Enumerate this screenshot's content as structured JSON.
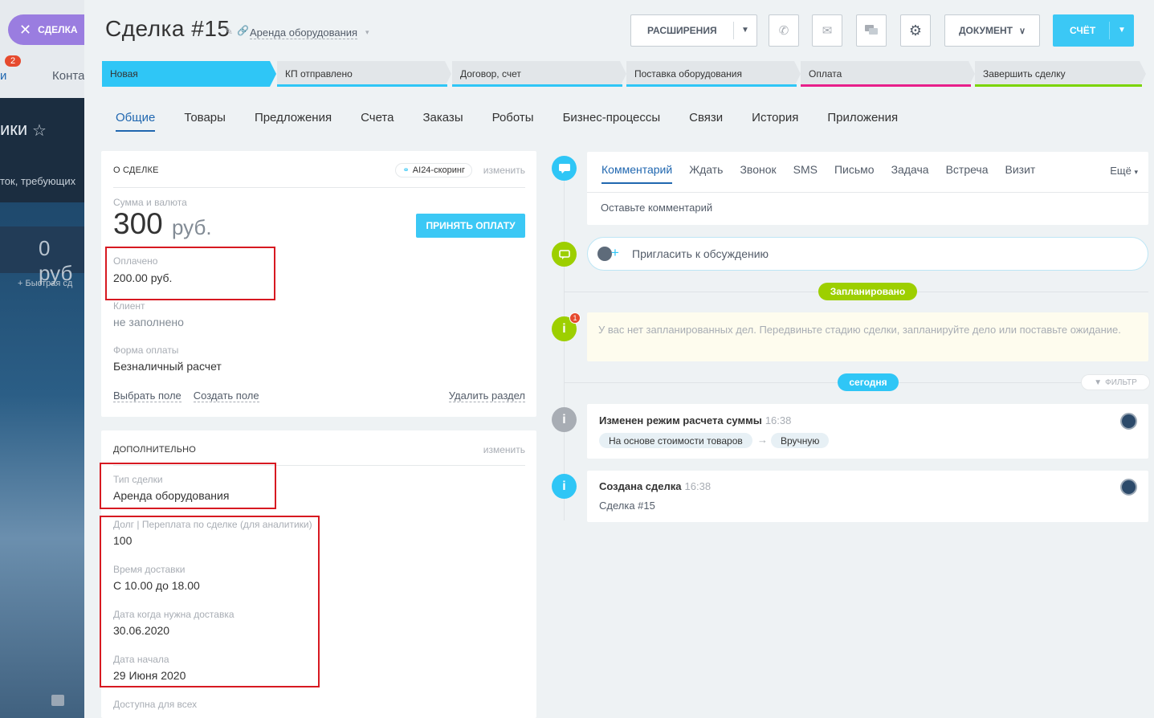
{
  "background": {
    "tab_badge": "2",
    "tab_left": "и",
    "tab_konta": "Конта",
    "stage_text": "ики",
    "hint_text": "ток, требующих",
    "sum_text": "0 руб",
    "quick_label": "+ Быстрая сд"
  },
  "slider": {
    "close_label": "СДЕЛКА"
  },
  "header": {
    "title": "Сделка  #15",
    "category": "Аренда оборудования",
    "ext_button": "РАСШИРЕНИЯ",
    "doc_button": "ДОКУМЕНТ",
    "bill_button": "СЧЁТ"
  },
  "stages": [
    {
      "label": "Новая",
      "color": "#2fc6f6",
      "active": true
    },
    {
      "label": "КП отправлено",
      "color": "#2fc6f6"
    },
    {
      "label": "Договор, счет",
      "color": "#2fc6f6"
    },
    {
      "label": "Поставка оборудования",
      "color": "#2fc6f6"
    },
    {
      "label": "Оплата",
      "color": "#e81f8a"
    },
    {
      "label": "Завершить сделку",
      "color": "#7bd500"
    }
  ],
  "tabs": [
    "Общие",
    "Товары",
    "Предложения",
    "Счета",
    "Заказы",
    "Роботы",
    "Бизнес-процессы",
    "Связи",
    "История",
    "Приложения"
  ],
  "about": {
    "heading": "О СДЕЛКЕ",
    "ai_badge": "AI24-скоринг",
    "change": "изменить",
    "sum_label": "Сумма и валюта",
    "sum_value": "300",
    "sum_currency": "руб.",
    "pay_button": "ПРИНЯТЬ ОПЛАТУ",
    "paid_label": "Оплачено",
    "paid_value": "200.00 руб.",
    "client_label": "Клиент",
    "client_value": "не заполнено",
    "payform_label": "Форма оплаты",
    "payform_value": "Безналичный расчет",
    "link_select": "Выбрать поле",
    "link_create": "Создать поле",
    "link_delete": "Удалить раздел"
  },
  "extra": {
    "heading": "ДОПОЛНИТЕЛЬНО",
    "change": "изменить",
    "type_label": "Тип сделки",
    "type_value": "Аренда оборудования",
    "debt_label": "Долг | Переплата по сделке (для аналитики)",
    "debt_value": "100",
    "delivery_label": "Время доставки",
    "delivery_value": "С 10.00 до 18.00",
    "date_label": "Дата когда нужна доставка",
    "date_value": "30.06.2020",
    "start_label": "Дата начала",
    "start_value": "29 Июня 2020",
    "available_label": "Доступна для всех"
  },
  "activity": {
    "tabs": [
      "Комментарий",
      "Ждать",
      "Звонок",
      "SMS",
      "Письмо",
      "Задача",
      "Встреча",
      "Визит"
    ],
    "more": "Ещё",
    "placeholder": "Оставьте комментарий",
    "invite": "Пригласить к обсуждению",
    "planned": "Запланировано",
    "badge_count": "1",
    "empty_text": "У вас нет запланированных дел. Передвиньте стадию сделки, запланируйте дело или поставьте ожидание.",
    "today": "сегодня",
    "filter": "ФИЛЬТР"
  },
  "events": [
    {
      "title": "Изменен режим расчета суммы",
      "time": "16:38",
      "from": "На основе стоимости товаров",
      "arrow": "→",
      "to": "Вручную"
    },
    {
      "title": "Создана сделка",
      "time": "16:38",
      "sub": "Сделка #15"
    }
  ],
  "colors": {
    "accent": "#2067b0",
    "primary_button": "#3bc8f5",
    "highlight_box": "#d71921",
    "planned": "#9dcf00"
  }
}
